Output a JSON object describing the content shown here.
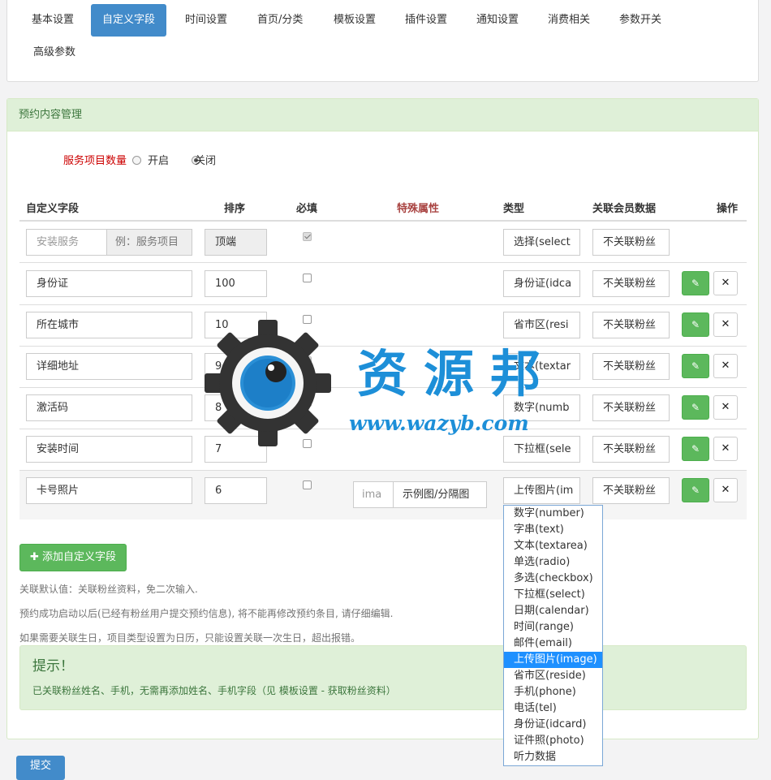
{
  "nav": {
    "tabs": [
      "基本设置",
      "自定义字段",
      "时间设置",
      "首页/分类",
      "模板设置",
      "插件设置",
      "通知设置",
      "消费相关",
      "参数开关",
      "高级参数"
    ],
    "active_index": 1
  },
  "panel": {
    "title": "预约内容管理",
    "service_count": {
      "label": "服务项目数量",
      "option_on": "开启",
      "option_off": "关闭",
      "selected": "关闭"
    },
    "columns": {
      "field": "自定义字段",
      "order": "排序",
      "required": "必填",
      "special": "特殊属性",
      "type": "类型",
      "linked": "关联会员数据",
      "action": "操作"
    },
    "first_row": {
      "placeholder": "安装服务",
      "addon": "例：服务项目",
      "order": "顶端",
      "type": "选择(select",
      "linked": "不关联粉丝"
    },
    "rows": [
      {
        "name": "身份证",
        "order": "100",
        "type": "身份证(idca",
        "linked": "不关联粉丝"
      },
      {
        "name": "所在城市",
        "order": "10",
        "type": "省市区(resi",
        "linked": "不关联粉丝"
      },
      {
        "name": "详细地址",
        "order": "9",
        "type": "文本(textar",
        "linked": "不关联粉丝"
      },
      {
        "name": "激活码",
        "order": "8",
        "type": "数字(numb",
        "linked": "不关联粉丝"
      },
      {
        "name": "安装时间",
        "order": "7",
        "type": "下拉框(sele",
        "linked": "不关联粉丝"
      },
      {
        "name": "卡号照片",
        "order": "6",
        "type": "上传图片(im",
        "linked": "不关联粉丝",
        "special_input": "ima",
        "special_label": "示例图/分隔图"
      }
    ],
    "add_button": "添加自定义字段",
    "help": [
      "关联默认值：关联粉丝资料，免二次输入.",
      "预约成功启动以后(已经有粉丝用户提交预约信息), 将不能再修改预约条目, 请仔细编辑.",
      "如果需要关联生日，项目类型设置为日历，只能设置关联一次生日，超出报错。"
    ],
    "alert": {
      "title": "提示！",
      "text": "已关联粉丝姓名、手机，无需再添加姓名、手机字段（见 模板设置 - 获取粉丝资料）"
    },
    "submit": "提交"
  },
  "dropdown": {
    "options": [
      "数字(number)",
      "字串(text)",
      "文本(textarea)",
      "单选(radio)",
      "多选(checkbox)",
      "下拉框(select)",
      "日期(calendar)",
      "时间(range)",
      "邮件(email)",
      "上传图片(image)",
      "省市区(reside)",
      "手机(phone)",
      "电话(tel)",
      "身份证(idcard)",
      "证件照(photo)",
      "听力数据"
    ],
    "selected_index": 9
  },
  "watermark": {
    "title": "资源邦",
    "url": "www.wazyb.com"
  },
  "colors": {
    "primary": "#428bca",
    "success": "#5cb85c",
    "panel_heading": "#dff0d8",
    "required_label": "#cc0000",
    "watermark": "#1d8fd8"
  }
}
